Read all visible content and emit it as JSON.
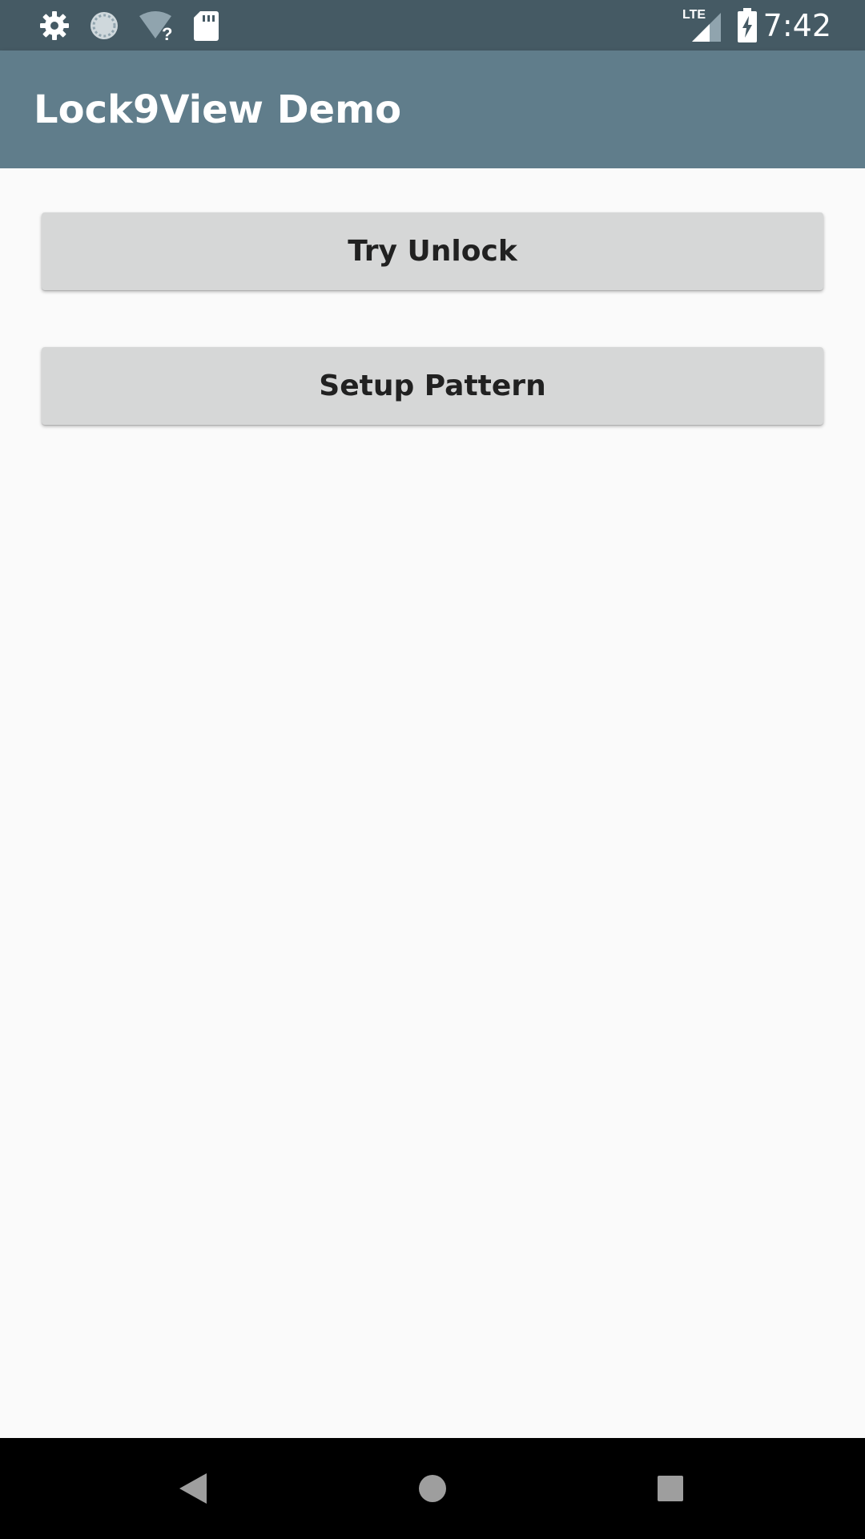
{
  "status_bar": {
    "time": "7:42",
    "network_label": "LTE",
    "icons": [
      "gear-icon",
      "sync-icon",
      "wifi-question-icon",
      "sd-card-icon",
      "lte-signal-icon",
      "battery-charging-icon"
    ]
  },
  "app_bar": {
    "title": "Lock9View Demo"
  },
  "main": {
    "buttons": [
      {
        "label": "Try Unlock"
      },
      {
        "label": "Setup Pattern"
      }
    ]
  },
  "nav_bar": {
    "icons": [
      "back-icon",
      "home-icon",
      "recents-icon"
    ]
  },
  "colors": {
    "status_bar": "#455a64",
    "app_bar": "#607d8b",
    "background": "#fafafa",
    "button": "#d6d7d7",
    "nav_bar": "#000000"
  }
}
